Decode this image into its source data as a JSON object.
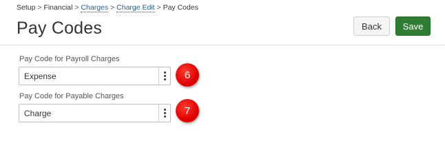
{
  "breadcrumb": {
    "items": [
      {
        "label": "Setup",
        "link": false
      },
      {
        "label": "Financial",
        "link": false
      },
      {
        "label": "Charges",
        "link": true
      },
      {
        "label": "Charge Edit",
        "link": true
      },
      {
        "label": "Pay Codes",
        "link": false
      }
    ],
    "separator": ">"
  },
  "header": {
    "title": "Pay Codes",
    "back_label": "Back",
    "save_label": "Save"
  },
  "form": {
    "fields": [
      {
        "label": "Pay Code for Payroll Charges",
        "value": "Expense",
        "callout": "6"
      },
      {
        "label": "Pay Code for Payable Charges",
        "value": "Charge",
        "callout": "7"
      }
    ]
  },
  "colors": {
    "save_bg": "#2e7d32",
    "link": "#1f5f99",
    "callout": "#e00000"
  },
  "icons": {
    "field_menu": "vertical-ellipsis-icon"
  }
}
